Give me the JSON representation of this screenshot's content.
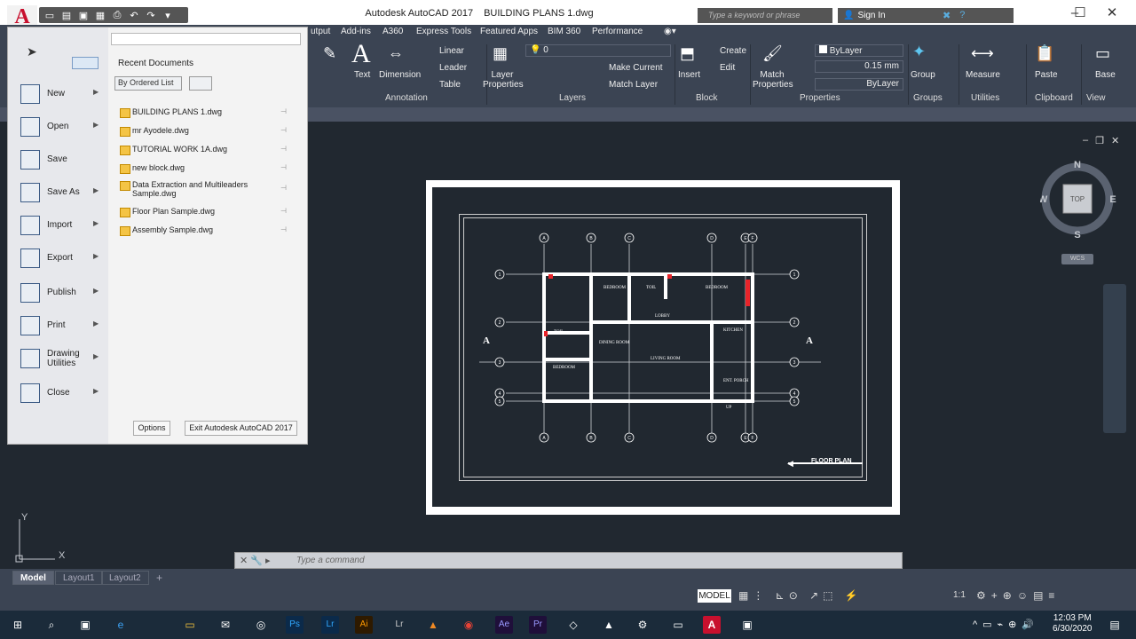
{
  "window": {
    "app_title": "Autodesk AutoCAD 2017",
    "file_title": "BUILDING PLANS 1.dwg",
    "search_placeholder": "Type a keyword or phrase",
    "sign_in": "Sign In",
    "app_button": "A"
  },
  "ribbon_tabs": [
    "utput",
    "Add-ins",
    "A360",
    "Express Tools",
    "Featured Apps",
    "BIM 360",
    "Performance"
  ],
  "ribbon": {
    "annotation": {
      "text": "Text",
      "dimension": "Dimension",
      "linear": "Linear",
      "leader": "Leader",
      "table": "Table",
      "panel": "Annotation"
    },
    "layers": {
      "layer_properties": "Layer Properties",
      "layer_value": "0",
      "make_current": "Make Current",
      "match_layer": "Match Layer",
      "panel": "Layers"
    },
    "block": {
      "insert": "Insert",
      "create": "Create",
      "edit": "Edit",
      "panel": "Block"
    },
    "properties": {
      "match_properties": "Match Properties",
      "color": "ByLayer",
      "lineweight": "0.15 mm",
      "linetype": "ByLayer",
      "panel": "Properties"
    },
    "groups": {
      "group": "Group",
      "panel": "Groups"
    },
    "utilities": {
      "measure": "Measure",
      "panel": "Utilities"
    },
    "clipboard": {
      "paste": "Paste",
      "panel": "Clipboard"
    },
    "view": {
      "base": "Base",
      "panel": "View"
    }
  },
  "app_menu": {
    "items": [
      {
        "label": "New",
        "icon": "new-file-icon"
      },
      {
        "label": "Open",
        "icon": "folder-open-icon"
      },
      {
        "label": "Save",
        "icon": "save-icon"
      },
      {
        "label": "Save As",
        "icon": "save-as-icon"
      },
      {
        "label": "Import",
        "icon": "import-icon"
      },
      {
        "label": "Export",
        "icon": "export-icon"
      },
      {
        "label": "Publish",
        "icon": "publish-icon"
      },
      {
        "label": "Print",
        "icon": "printer-icon"
      },
      {
        "label": "Drawing Utilities",
        "icon": "drawing-utilities-icon"
      },
      {
        "label": "Close",
        "icon": "close-file-icon"
      }
    ],
    "recent_title": "Recent Documents",
    "ordered_list": "By Ordered List",
    "recent_documents": [
      "BUILDING PLANS 1.dwg",
      "mr Ayodele.dwg",
      "TUTORIAL WORK 1A.dwg",
      "new block.dwg",
      "Data Extraction and Multileaders Sample.dwg",
      "Floor Plan Sample.dwg",
      "Assembly Sample.dwg"
    ],
    "options_button": "Options",
    "exit_button": "Exit Autodesk AutoCAD 2017"
  },
  "drawing": {
    "title": "FLOOR PLAN",
    "section_marks": [
      "A",
      "A"
    ],
    "grid_top": [
      "A",
      "B",
      "C",
      "D",
      "E",
      "F"
    ],
    "grid_side": [
      "1",
      "2",
      "3",
      "4",
      "5"
    ],
    "room_labels": [
      "BEDROOM",
      "TOIL",
      "BEDROOM",
      "LOBBY",
      "TOIL",
      "DINING ROOM",
      "LIVING ROOM",
      "BEDROOM",
      "KITCHEN",
      "ENT. PORCH",
      "UP"
    ]
  },
  "viewcube": {
    "n": "N",
    "s": "S",
    "e": "E",
    "w": "W",
    "face": "TOP",
    "wcs": "WCS"
  },
  "command_line": {
    "placeholder": "Type a command"
  },
  "layout_tabs": [
    "Model",
    "Layout1",
    "Layout2"
  ],
  "status": {
    "model": "MODEL",
    "scale": "1:1"
  },
  "taskbar": {
    "time": "12:03 PM",
    "date": "6/30/2020"
  },
  "ucs": {
    "x": "X",
    "y": "Y"
  }
}
